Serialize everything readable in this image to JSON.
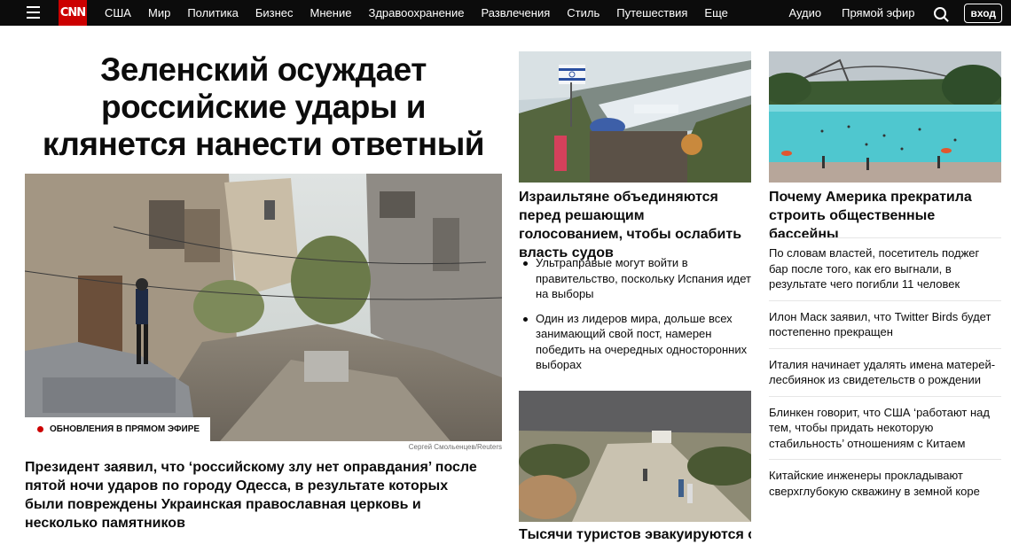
{
  "nav": {
    "links": [
      "США",
      "Мир",
      "Политика",
      "Бизнес",
      "Мнение",
      "Здравоохранение",
      "Развлечения",
      "Стиль",
      "Путешествия",
      "Еще"
    ],
    "audio": "Аудио",
    "live": "Прямой эфир",
    "login": "вход",
    "logo": "CNN"
  },
  "lead": {
    "headline": "Зеленский осуждает российские удары и клянется нанести ответный удар",
    "credit": "Сергей Смольенцев/Reuters",
    "live_badge": "Обновления в прямом эфире",
    "subheadline": "Президент заявил, что ‘российскому злу нет оправдания’ после пятой ночи ударов по городу Одесса, в результате которых были повреждены Украинская православная церковь и несколько памятников"
  },
  "middle": {
    "headline": "Израильтяне объединяются перед решающим голосованием, чтобы ослабить власть судов",
    "bullets": [
      "Ультраправые могут войти в правительство, поскольку Испания идет на выборы",
      "Один из лидеров мира, дольше всех занимающий свой пост, намерен победить на очередных односторонних выборах"
    ],
    "cut_headline": "Тысячи туристов эвакуируются с"
  },
  "right": {
    "headline": "Почему Америка прекратила строить общественные бассейны",
    "items": [
      "По словам властей, посетитель поджег бар после того, как его выгнали, в результате чего погибли 11 человек",
      "Илон Маск заявил, что Twitter Birds будет постепенно прекращен",
      "Италия начинает удалять имена матерей-лесбиянок из свидетельств о рождении",
      "Блинкен говорит, что США ‘работают над тем, чтобы придать некоторую стабильность’ отношениям с Китаем",
      "Китайские инженеры прокладывают сверхглубокую скважину в земной коре"
    ]
  },
  "colors": {
    "nav_bg": "#0c0c0c",
    "brand_red": "#cc0000"
  }
}
